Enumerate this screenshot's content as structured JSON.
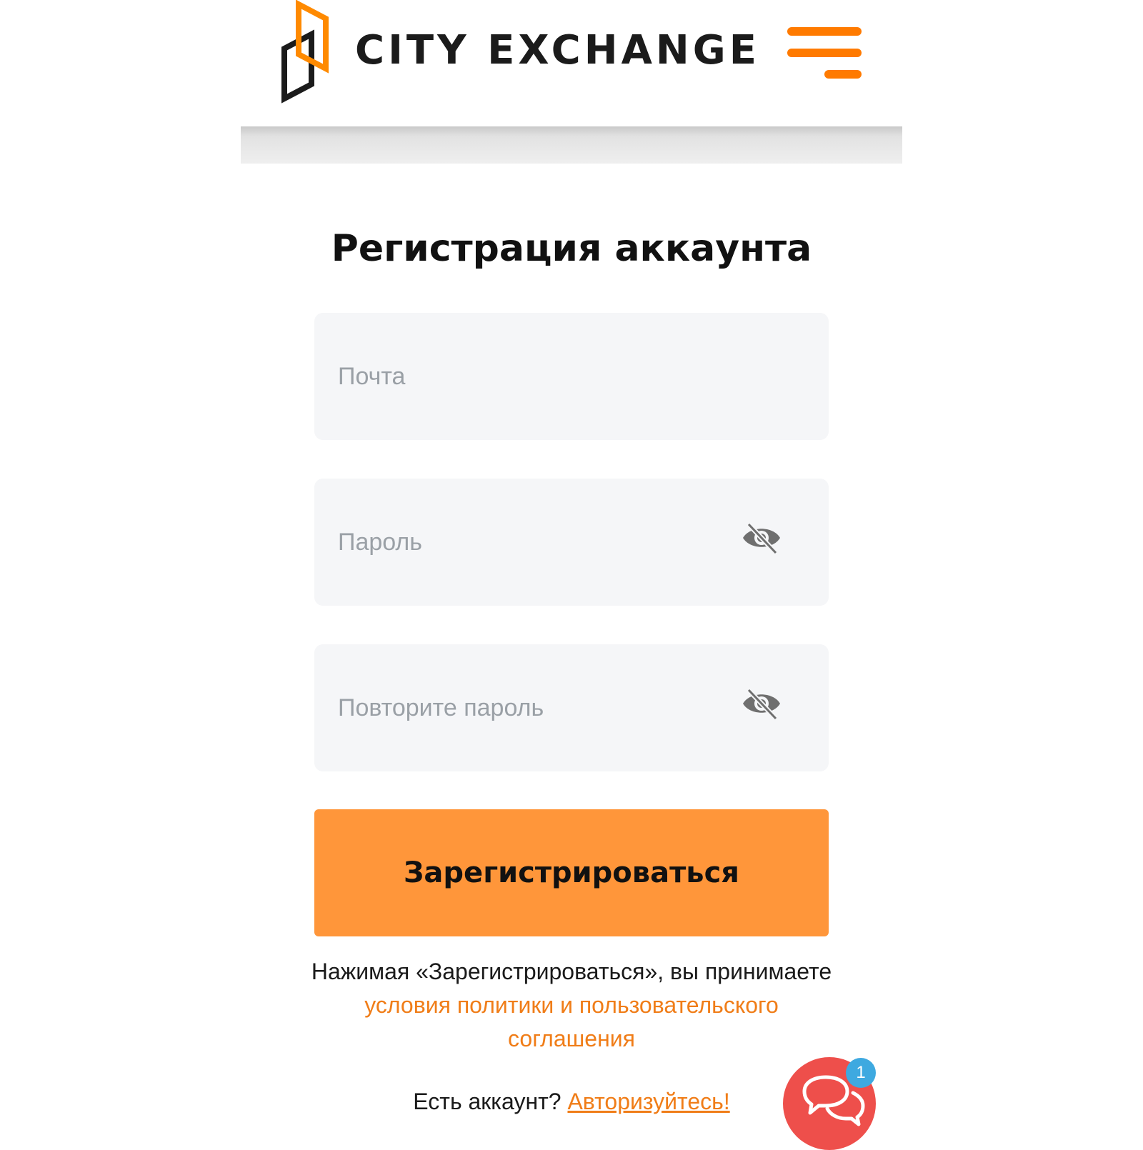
{
  "header": {
    "brand": "CITY EXCHANGE",
    "logo_icon": "city-exchange-logo",
    "menu_icon": "hamburger-menu-icon",
    "accent_color": "#ff7a00"
  },
  "form": {
    "title": "Регистрация аккаунта",
    "email_placeholder": "Почта",
    "password_placeholder": "Пароль",
    "repeat_password_placeholder": "Повторите пароль",
    "visibility_icon": "eye-slash-icon",
    "submit_label": "Зарегистрироваться",
    "submit_color": "#ff963a"
  },
  "terms": {
    "prefix": "Нажимая «Зарегистрироваться», вы принимаете ",
    "link_text": "условия политики и пользовательского соглашения"
  },
  "login": {
    "prompt": "Есть аккаунт? ",
    "link_text": "Авторизуйтесь!"
  },
  "chat": {
    "icon": "chat-bubbles-icon",
    "badge_count": "1",
    "color": "#ee4f4b"
  }
}
